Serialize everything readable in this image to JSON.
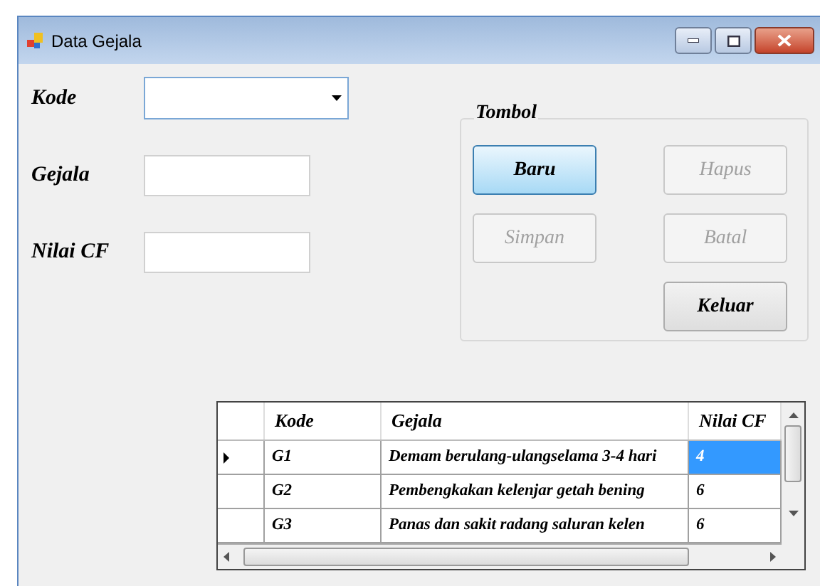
{
  "window": {
    "title": "Data Gejala"
  },
  "fields": [
    {
      "label": "Kode",
      "kind": "combo"
    },
    {
      "label": "Gejala",
      "kind": "text"
    },
    {
      "label": "Nilai CF",
      "kind": "text"
    }
  ],
  "group": {
    "title": "Tombol",
    "buttons": [
      {
        "label": "Baru",
        "disabled": false,
        "highlighted": true
      },
      {
        "label": "Hapus",
        "disabled": true,
        "highlighted": false
      },
      {
        "label": "Simpan",
        "disabled": true,
        "highlighted": false
      },
      {
        "label": "Batal",
        "disabled": true,
        "highlighted": false
      },
      {
        "label": "Keluar",
        "disabled": false,
        "highlighted": false
      }
    ]
  },
  "table": {
    "columns": [
      "Kode",
      "Gejala",
      "Nilai CF"
    ],
    "rows": [
      {
        "current": true,
        "cells": [
          {
            "text": "G1",
            "selected": false
          },
          {
            "text": "Demam berulang-ulangselama 3-4 hari",
            "selected": false
          },
          {
            "text": "4",
            "selected": true
          }
        ]
      },
      {
        "current": false,
        "cells": [
          {
            "text": "G2",
            "selected": false
          },
          {
            "text": "Pembengkakan kelenjar getah bening",
            "selected": false
          },
          {
            "text": "6",
            "selected": false
          }
        ]
      },
      {
        "current": false,
        "cells": [
          {
            "text": "G3",
            "selected": false
          },
          {
            "text": "Panas dan sakit radang saluran kelen",
            "selected": false
          },
          {
            "text": "6",
            "selected": false
          }
        ]
      }
    ]
  }
}
